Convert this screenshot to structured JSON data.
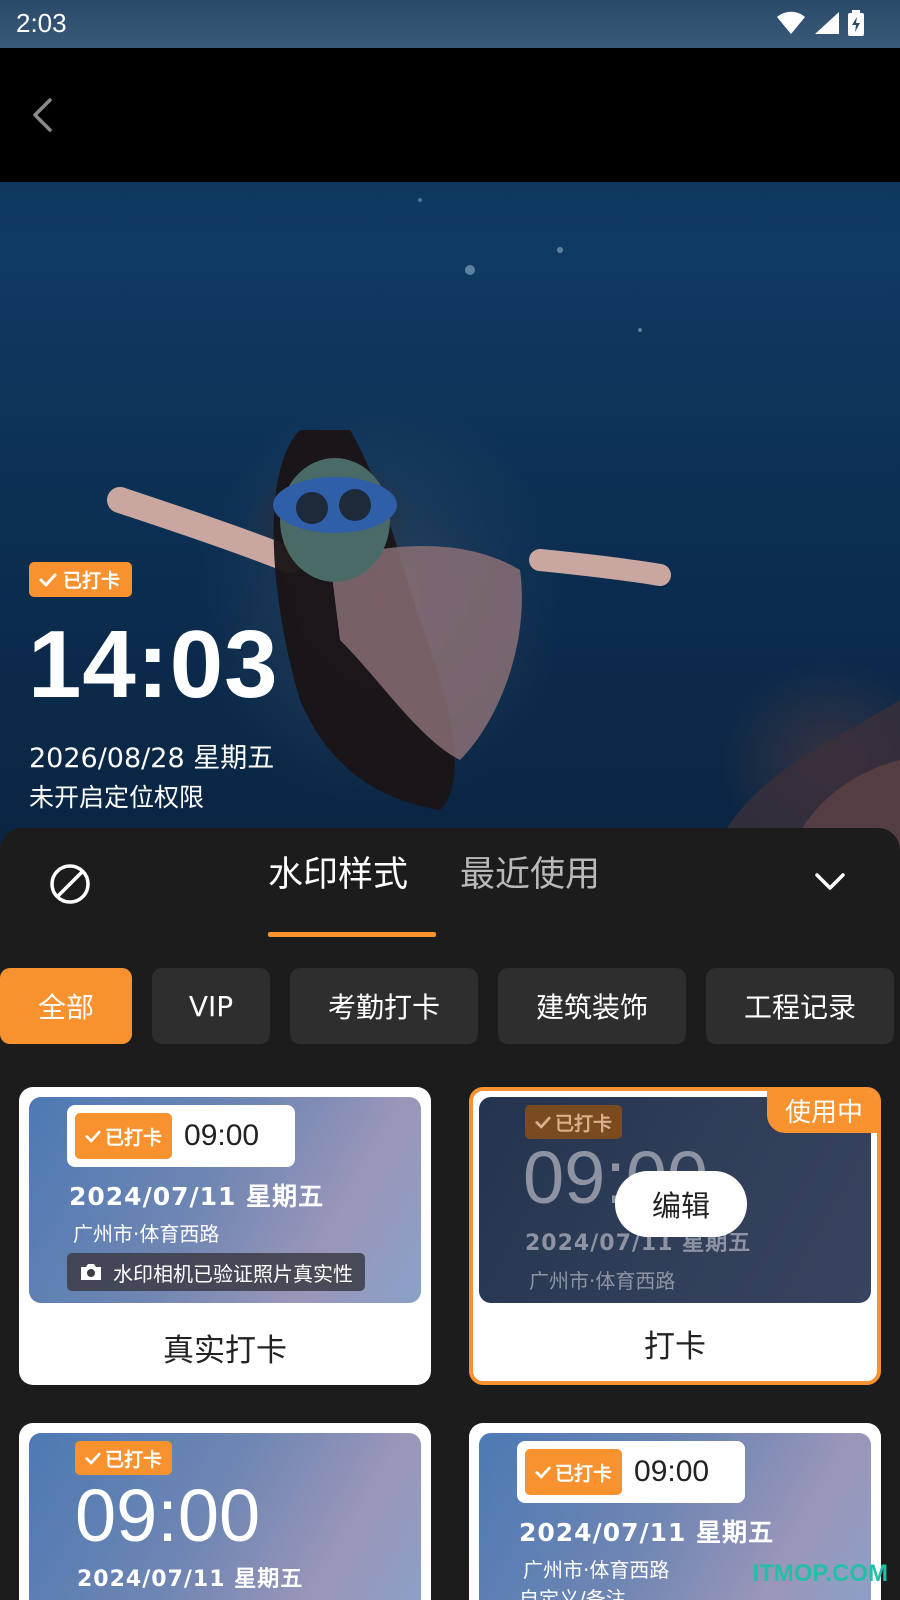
{
  "status_bar": {
    "time": "2:03"
  },
  "watermark_preview": {
    "badge": "已打卡",
    "time": "14:03",
    "date": "2026/08/28 星期五",
    "location": "未开启定位权限"
  },
  "panel": {
    "tabs": [
      {
        "label": "水印样式",
        "active": true
      },
      {
        "label": "最近使用",
        "active": false
      }
    ],
    "categories": [
      {
        "label": "全部",
        "active": true
      },
      {
        "label": "VIP",
        "active": false
      },
      {
        "label": "考勤打卡",
        "active": false
      },
      {
        "label": "建筑装饰",
        "active": false
      },
      {
        "label": "工程记录",
        "active": false
      }
    ]
  },
  "cards": [
    {
      "title": "真实打卡",
      "badge": "已打卡",
      "time": "09:00",
      "date": "2024/07/11 星期五",
      "location": "广州市·体育西路",
      "verify_text": "水印相机已验证照片真实性"
    },
    {
      "title": "打卡",
      "badge": "已打卡",
      "time": "09:00",
      "date": "2024/07/11 星期五",
      "location": "广州市·体育西路",
      "in_use_label": "使用中",
      "edit_label": "编辑"
    },
    {
      "badge": "已打卡",
      "time": "09:00",
      "date": "2024/07/11 星期五"
    },
    {
      "badge": "已打卡",
      "time": "09:00",
      "date": "2024/07/11 星期五",
      "location": "广州市·体育西路",
      "note": "自定义/备注"
    }
  ],
  "site_watermark": "ITMOP.COM",
  "colors": {
    "accent": "#f7922e",
    "panel_bg": "#1c1c1c",
    "chip_bg": "#2e2e2e"
  }
}
